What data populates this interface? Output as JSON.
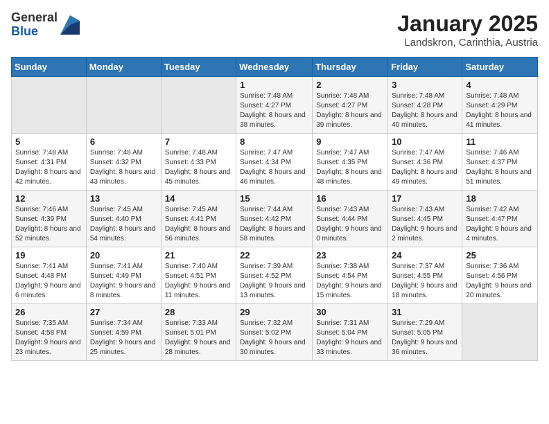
{
  "logo": {
    "general": "General",
    "blue": "Blue"
  },
  "title": "January 2025",
  "subtitle": "Landskron, Carinthia, Austria",
  "days_of_week": [
    "Sunday",
    "Monday",
    "Tuesday",
    "Wednesday",
    "Thursday",
    "Friday",
    "Saturday"
  ],
  "weeks": [
    [
      {
        "day": "",
        "empty": true
      },
      {
        "day": "",
        "empty": true
      },
      {
        "day": "",
        "empty": true
      },
      {
        "day": "1",
        "sunrise": "7:48 AM",
        "sunset": "4:27 PM",
        "daylight": "8 hours and 38 minutes."
      },
      {
        "day": "2",
        "sunrise": "7:48 AM",
        "sunset": "4:27 PM",
        "daylight": "8 hours and 39 minutes."
      },
      {
        "day": "3",
        "sunrise": "7:48 AM",
        "sunset": "4:28 PM",
        "daylight": "8 hours and 40 minutes."
      },
      {
        "day": "4",
        "sunrise": "7:48 AM",
        "sunset": "4:29 PM",
        "daylight": "8 hours and 41 minutes."
      }
    ],
    [
      {
        "day": "5",
        "sunrise": "7:48 AM",
        "sunset": "4:31 PM",
        "daylight": "8 hours and 42 minutes."
      },
      {
        "day": "6",
        "sunrise": "7:48 AM",
        "sunset": "4:32 PM",
        "daylight": "8 hours and 43 minutes."
      },
      {
        "day": "7",
        "sunrise": "7:48 AM",
        "sunset": "4:33 PM",
        "daylight": "8 hours and 45 minutes."
      },
      {
        "day": "8",
        "sunrise": "7:47 AM",
        "sunset": "4:34 PM",
        "daylight": "8 hours and 46 minutes."
      },
      {
        "day": "9",
        "sunrise": "7:47 AM",
        "sunset": "4:35 PM",
        "daylight": "8 hours and 48 minutes."
      },
      {
        "day": "10",
        "sunrise": "7:47 AM",
        "sunset": "4:36 PM",
        "daylight": "8 hours and 49 minutes."
      },
      {
        "day": "11",
        "sunrise": "7:46 AM",
        "sunset": "4:37 PM",
        "daylight": "8 hours and 51 minutes."
      }
    ],
    [
      {
        "day": "12",
        "sunrise": "7:46 AM",
        "sunset": "4:39 PM",
        "daylight": "8 hours and 52 minutes."
      },
      {
        "day": "13",
        "sunrise": "7:45 AM",
        "sunset": "4:40 PM",
        "daylight": "8 hours and 54 minutes."
      },
      {
        "day": "14",
        "sunrise": "7:45 AM",
        "sunset": "4:41 PM",
        "daylight": "8 hours and 56 minutes."
      },
      {
        "day": "15",
        "sunrise": "7:44 AM",
        "sunset": "4:42 PM",
        "daylight": "8 hours and 58 minutes."
      },
      {
        "day": "16",
        "sunrise": "7:43 AM",
        "sunset": "4:44 PM",
        "daylight": "9 hours and 0 minutes."
      },
      {
        "day": "17",
        "sunrise": "7:43 AM",
        "sunset": "4:45 PM",
        "daylight": "9 hours and 2 minutes."
      },
      {
        "day": "18",
        "sunrise": "7:42 AM",
        "sunset": "4:47 PM",
        "daylight": "9 hours and 4 minutes."
      }
    ],
    [
      {
        "day": "19",
        "sunrise": "7:41 AM",
        "sunset": "4:48 PM",
        "daylight": "9 hours and 6 minutes."
      },
      {
        "day": "20",
        "sunrise": "7:41 AM",
        "sunset": "4:49 PM",
        "daylight": "9 hours and 8 minutes."
      },
      {
        "day": "21",
        "sunrise": "7:40 AM",
        "sunset": "4:51 PM",
        "daylight": "9 hours and 11 minutes."
      },
      {
        "day": "22",
        "sunrise": "7:39 AM",
        "sunset": "4:52 PM",
        "daylight": "9 hours and 13 minutes."
      },
      {
        "day": "23",
        "sunrise": "7:38 AM",
        "sunset": "4:54 PM",
        "daylight": "9 hours and 15 minutes."
      },
      {
        "day": "24",
        "sunrise": "7:37 AM",
        "sunset": "4:55 PM",
        "daylight": "9 hours and 18 minutes."
      },
      {
        "day": "25",
        "sunrise": "7:36 AM",
        "sunset": "4:56 PM",
        "daylight": "9 hours and 20 minutes."
      }
    ],
    [
      {
        "day": "26",
        "sunrise": "7:35 AM",
        "sunset": "4:58 PM",
        "daylight": "9 hours and 23 minutes."
      },
      {
        "day": "27",
        "sunrise": "7:34 AM",
        "sunset": "4:59 PM",
        "daylight": "9 hours and 25 minutes."
      },
      {
        "day": "28",
        "sunrise": "7:33 AM",
        "sunset": "5:01 PM",
        "daylight": "9 hours and 28 minutes."
      },
      {
        "day": "29",
        "sunrise": "7:32 AM",
        "sunset": "5:02 PM",
        "daylight": "9 hours and 30 minutes."
      },
      {
        "day": "30",
        "sunrise": "7:31 AM",
        "sunset": "5:04 PM",
        "daylight": "9 hours and 33 minutes."
      },
      {
        "day": "31",
        "sunrise": "7:29 AM",
        "sunset": "5:05 PM",
        "daylight": "9 hours and 36 minutes."
      },
      {
        "day": "",
        "empty": true
      }
    ]
  ],
  "labels": {
    "sunrise": "Sunrise:",
    "sunset": "Sunset:",
    "daylight": "Daylight:"
  }
}
